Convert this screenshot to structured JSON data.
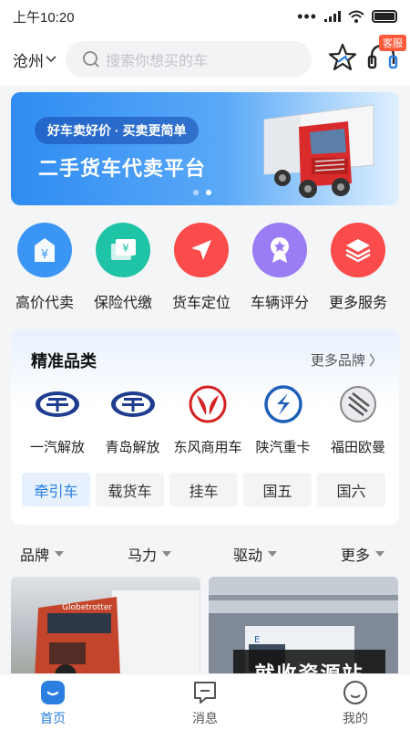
{
  "status_bar": {
    "time": "上午10:20",
    "more": "•••"
  },
  "header": {
    "city": "沧州",
    "search_placeholder": "搜索你想买的车",
    "service_tag": "客服"
  },
  "banner": {
    "pill": "好车卖好价 · 买卖更简单",
    "title": "二手货车代卖平台"
  },
  "quick_actions": [
    {
      "label": "高价代卖",
      "icon": "price-tag-icon",
      "color": "#3a95f5"
    },
    {
      "label": "保险代缴",
      "icon": "insurance-icon",
      "color": "#1fc3a5"
    },
    {
      "label": "货车定位",
      "icon": "location-arrow-icon",
      "color": "#fb4b4b"
    },
    {
      "label": "车辆评分",
      "icon": "rating-badge-icon",
      "color": "#9a7cf5"
    },
    {
      "label": "更多服务",
      "icon": "layers-icon",
      "color": "#fb4b4b"
    }
  ],
  "category": {
    "title": "精准品类",
    "more": "更多品牌 〉",
    "brands": [
      {
        "label": "一汽解放"
      },
      {
        "label": "青岛解放"
      },
      {
        "label": "东风商用车"
      },
      {
        "label": "陕汽重卡"
      },
      {
        "label": "福田欧曼"
      }
    ],
    "tags": [
      "牵引车",
      "载货车",
      "挂车",
      "国五",
      "国六"
    ]
  },
  "filters": [
    "品牌",
    "马力",
    "驱动",
    "更多"
  ],
  "cards": {
    "left_brand": "Globetrotter"
  },
  "watermark": "就收资源站",
  "tabbar": [
    {
      "label": "首页"
    },
    {
      "label": "消息"
    },
    {
      "label": "我的"
    }
  ]
}
